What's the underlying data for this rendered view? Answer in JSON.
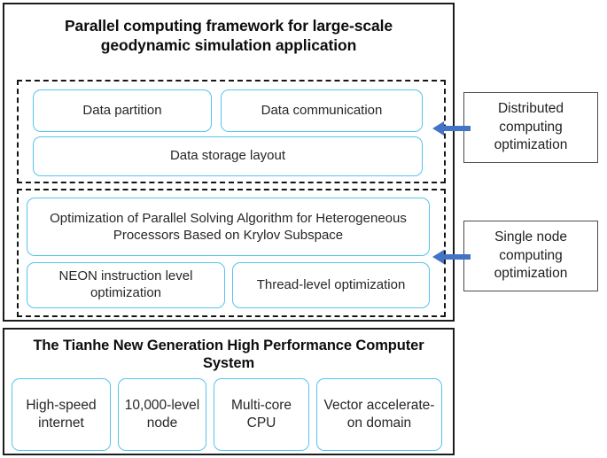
{
  "diagram": {
    "top_panel": {
      "title": "Parallel computing framework for large-scale geodynamic simulation application",
      "groups": [
        {
          "name": "distributed-computing-optimization",
          "boxes": [
            {
              "label": "Data partition"
            },
            {
              "label": "Data communication"
            },
            {
              "label": "Data storage layout"
            }
          ],
          "annotation": "Distributed computing optimization"
        },
        {
          "name": "single-node-computing-optimization",
          "boxes": [
            {
              "label": "Optimization of Parallel Solving Algorithm for Heterogeneous Processors Based on Krylov Subspace"
            },
            {
              "label": "NEON instruction level optimization"
            },
            {
              "label": "Thread-level optimization"
            }
          ],
          "annotation": "Single node computing optimization"
        }
      ]
    },
    "bottom_panel": {
      "title": "The Tianhe New Generation High Performance Computer System",
      "boxes": [
        {
          "label": "High-speed internet"
        },
        {
          "label": "10,000-level node"
        },
        {
          "label": "Multi-core CPU"
        },
        {
          "label": "Vector accelerate-on domain"
        }
      ]
    },
    "icons": {
      "arrow_left": "arrow-left-icon"
    },
    "colors": {
      "box_border": "#57c4ec",
      "arrow": "#4472c4",
      "frame": "#1c1c1c",
      "dashed_group": "#151515"
    }
  }
}
